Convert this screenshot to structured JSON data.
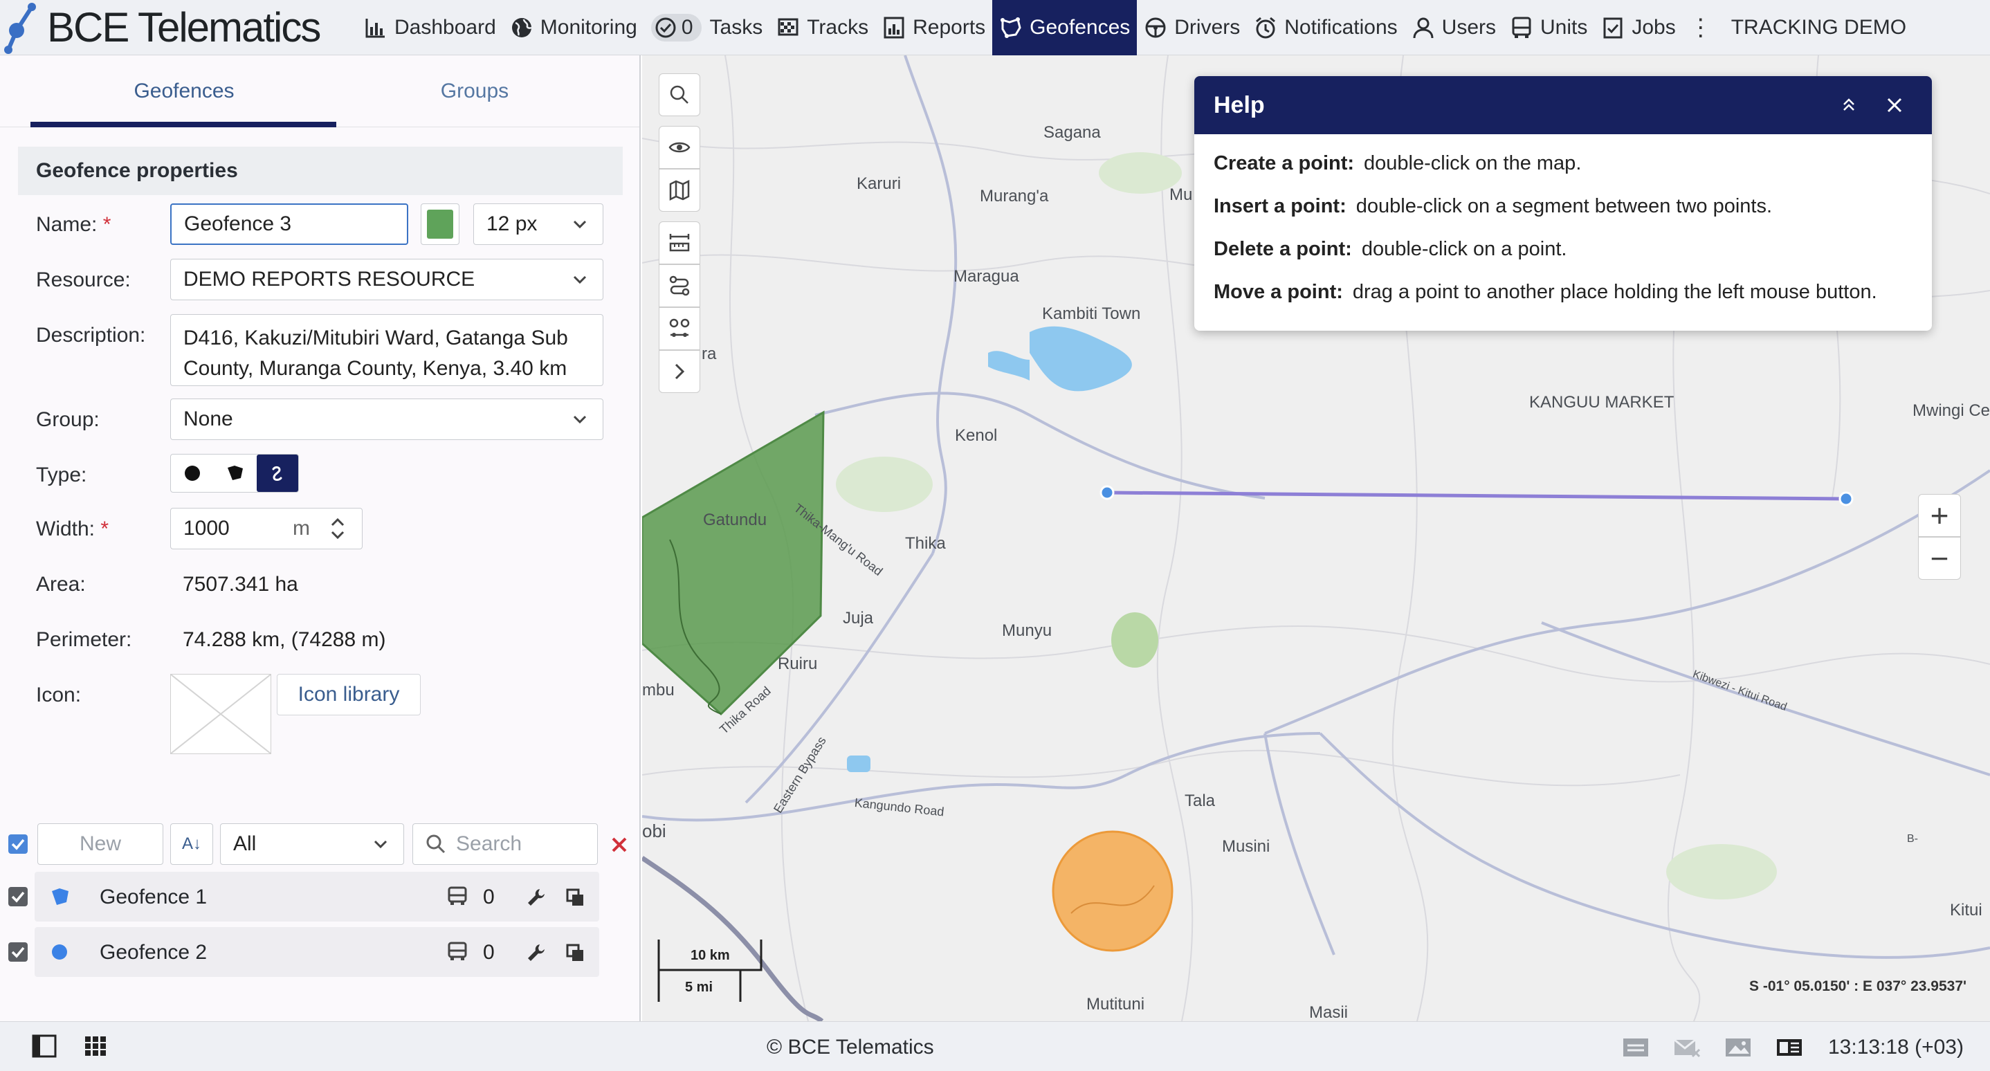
{
  "brand": "BCE Telematics",
  "nav": [
    {
      "label": "Dashboard",
      "icon": "bar-chart-icon"
    },
    {
      "label": "Monitoring",
      "icon": "globe-icon"
    },
    {
      "label": "Tasks",
      "icon": "check-circle-icon",
      "count": "0"
    },
    {
      "label": "Tracks",
      "icon": "flag-icon"
    },
    {
      "label": "Reports",
      "icon": "report-icon"
    },
    {
      "label": "Geofences",
      "icon": "geofence-icon",
      "active": true
    },
    {
      "label": "Drivers",
      "icon": "steering-wheel-icon"
    },
    {
      "label": "Notifications",
      "icon": "alarm-clock-icon"
    },
    {
      "label": "Users",
      "icon": "user-icon"
    },
    {
      "label": "Units",
      "icon": "bus-icon"
    },
    {
      "label": "Jobs",
      "icon": "clipboard-check-icon"
    }
  ],
  "more_menu": "⋮",
  "account": "TRACKING DEMO",
  "tabs": {
    "geofences": "Geofences",
    "groups": "Groups"
  },
  "props": {
    "header": "Geofence properties",
    "name_label": "Name:",
    "name_value": "Geofence 3",
    "color": "#5fa35a",
    "line_width": "12 px",
    "resource_label": "Resource:",
    "resource_value": "DEMO REPORTS RESOURCE",
    "description_label": "Description:",
    "description_line1": "D416, Kakuzi/Mitubiri Ward, Gatanga Sub",
    "description_line2": "County, Muranga County, Kenya, 3.40 km",
    "group_label": "Group:",
    "group_value": "None",
    "type_label": "Type:",
    "type_options": [
      "circle",
      "polygon",
      "line"
    ],
    "type_selected": "line",
    "width_label": "Width:",
    "width_value": "1000",
    "width_unit": "m",
    "area_label": "Area:",
    "area_value": "7507.341 ha",
    "perimeter_label": "Perimeter:",
    "perimeter_value": "74.288 km, (74288 m)",
    "icon_label": "Icon:",
    "icon_library": "Icon library",
    "required_mark": "*"
  },
  "list_toolbar": {
    "new_placeholder": "New",
    "sort_label": "A↓",
    "filter_value": "All",
    "search_placeholder": "Search"
  },
  "geofences": [
    {
      "name": "Geofence 1",
      "shape": "polygon",
      "color": "#3b82e6",
      "units": "0",
      "checked": true
    },
    {
      "name": "Geofence 2",
      "shape": "circle",
      "color": "#3b82e6",
      "units": "0",
      "checked": true
    }
  ],
  "help": {
    "title": "Help",
    "lines": [
      {
        "key": "Create a point:",
        "text": "double-click on the map."
      },
      {
        "key": "Insert a point:",
        "text": "double-click on a segment between two points."
      },
      {
        "key": "Delete a point:",
        "text": "double-click on a point."
      },
      {
        "key": "Move a point:",
        "text": "drag a point to another place holding the left mouse button."
      }
    ]
  },
  "map": {
    "labels": [
      "Sagana",
      "Karuri",
      "Murang'a",
      "Mu",
      "Maragua",
      "Kambiti Town",
      "KANGUU MARKET",
      "Mwingi Ce",
      "Kenol",
      "Gatundu",
      "Thika",
      "Thika-Mang'u Road",
      "Juja",
      "Munyu",
      "Ruiru",
      "mbu",
      "Thika Road",
      "Eastern Bypass",
      "Kangundo Road",
      "Tala",
      "Musini",
      "obi",
      "Mutituni",
      "Masii",
      "Kitui",
      "Kibwezi - Kitui Road",
      "B-",
      "ra"
    ],
    "scale_km": "10 km",
    "scale_mi": "5 mi",
    "coordinates": "S -01° 05.0150' : E 037° 23.9537'",
    "zoom_in": "+",
    "zoom_out": "−"
  },
  "footer": {
    "copyright": "© BCE Telematics",
    "clock": "13:13:18 (+03)"
  }
}
